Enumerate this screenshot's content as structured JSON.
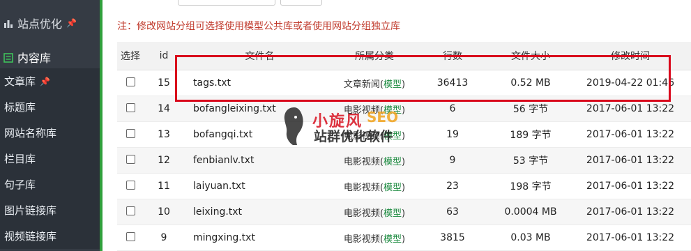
{
  "sidebar": {
    "group1": "站点优化",
    "group2": "内容库",
    "items": [
      {
        "label": "文章库",
        "pinned": true
      },
      {
        "label": "标题库"
      },
      {
        "label": "网站名称库"
      },
      {
        "label": "栏目库"
      },
      {
        "label": "句子库"
      },
      {
        "label": "图片链接库"
      },
      {
        "label": "视频链接库"
      }
    ]
  },
  "note": "注：修改网站分组可选择使用模型公共库或者使用网站分组独立库",
  "table": {
    "headers": {
      "select": "选择",
      "id": "id",
      "name": "文件名",
      "category": "所属分类",
      "lines": "行数",
      "size": "文件大小",
      "modified": "修改时间"
    },
    "rows": [
      {
        "id": "15",
        "name": "tags.txt",
        "category": "文章新闻",
        "model": "模型",
        "lines": "36413",
        "size": "0.52 MB",
        "modified": "2019-04-22 01:46"
      },
      {
        "id": "14",
        "name": "bofangleixing.txt",
        "category": "电影视频",
        "model": "模型",
        "lines": "6",
        "size": "56 字节",
        "modified": "2017-06-01 13:22"
      },
      {
        "id": "13",
        "name": "bofangqi.txt",
        "category": "电影视频",
        "model": "模型",
        "lines": "19",
        "size": "189 字节",
        "modified": "2017-06-01 13:22"
      },
      {
        "id": "12",
        "name": "fenbianlv.txt",
        "category": "电影视频",
        "model": "模型",
        "lines": "9",
        "size": "53 字节",
        "modified": "2017-06-01 13:22"
      },
      {
        "id": "11",
        "name": "laiyuan.txt",
        "category": "电影视频",
        "model": "模型",
        "lines": "23",
        "size": "198 字节",
        "modified": "2017-06-01 13:22"
      },
      {
        "id": "10",
        "name": "leixing.txt",
        "category": "电影视频",
        "model": "模型",
        "lines": "63",
        "size": "0.0004 MB",
        "modified": "2017-06-01 13:22"
      },
      {
        "id": "9",
        "name": "mingxing.txt",
        "category": "电影视频",
        "model": "模型",
        "lines": "3815",
        "size": "0.03 MB",
        "modified": "2017-06-01 13:22"
      }
    ]
  },
  "watermark": {
    "brand_cn": "小旋风",
    "brand_en": "SEO",
    "tagline": "站群优化软件"
  },
  "colors": {
    "sidebar_bg": "#353b44",
    "accent_green": "#2f9f3b",
    "note_red": "#c0392b",
    "highlight_red": "#d9071b",
    "model_link": "#1b8a3f"
  }
}
